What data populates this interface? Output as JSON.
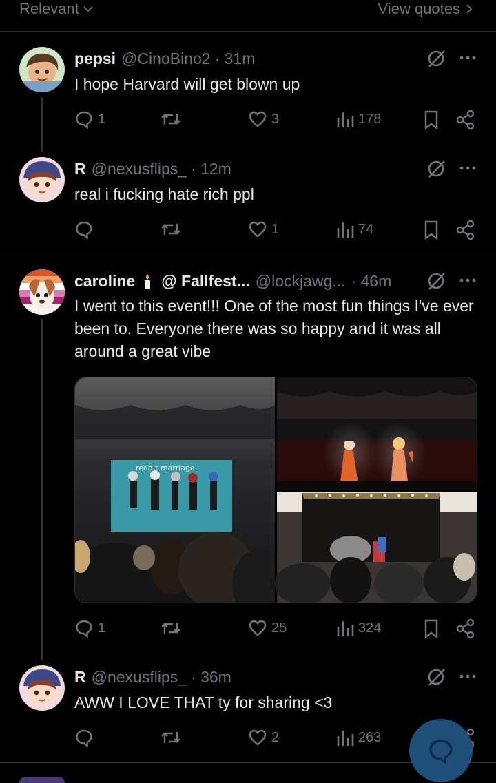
{
  "topbar": {
    "sort_label": "Relevant",
    "view_quotes": "View quotes"
  },
  "posts": [
    {
      "name": "pepsi",
      "handle": "@CinoBino2",
      "time": "· 31m",
      "text": "I hope Harvard will get blown up",
      "replies": "1",
      "reposts": "",
      "likes": "3",
      "views": "178"
    },
    {
      "name": "R",
      "handle": "@nexusflips_",
      "time": "· 12m",
      "text": "real i fucking hate rich ppl",
      "replies": "",
      "reposts": "",
      "likes": "1",
      "views": "74"
    },
    {
      "name": "caroline",
      "name_extra": "@ Fallfest...",
      "handle": "@lockjawg...",
      "time": "· 46m",
      "text": "I went to this event!!! One of the most fun things I've ever been to. Everyone there was so happy and it was all around a great vibe",
      "media_caption": "reddit marriage",
      "replies": "1",
      "reposts": "",
      "likes": "25",
      "views": "324"
    },
    {
      "name": "R",
      "handle": "@nexusflips_",
      "time": "· 36m",
      "text": "AWW I LOVE THAT ty for sharing <3",
      "replies": "",
      "reposts": "",
      "likes": "2",
      "views": "263"
    }
  ],
  "colors": {
    "bg": "#000000",
    "text": "#e7e9ea",
    "muted": "#71767b",
    "border": "#2f3336",
    "fab": "#1d4f78"
  },
  "icons": [
    "chevron-down-icon",
    "chevron-right-icon",
    "grok-icon",
    "more-icon",
    "reply-icon",
    "repost-icon",
    "like-icon",
    "views-icon",
    "bookmark-icon",
    "share-icon",
    "compose-reply-icon"
  ]
}
